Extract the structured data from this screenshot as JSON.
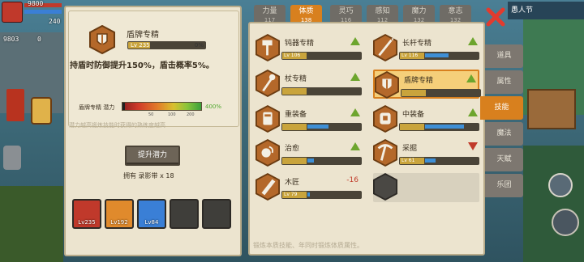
{
  "hud": {
    "top_numbers": [
      "9800",
      "240"
    ],
    "side_numbers": [
      "9803",
      "0"
    ]
  },
  "left_panel": {
    "skill_name": "盾牌专精",
    "level_label": "Lv 235",
    "level_fill": 0.28,
    "progress_pct": "0%",
    "effect_text": "持盾时防御提升150%，盾击概率5%。",
    "potential_label": "盾牌专精 潜力",
    "potential_ticks": [
      "50",
      "100",
      "200"
    ],
    "potential_max": "400%",
    "potential_note": "潜力越高锻炼技能时获得的熟练度越高",
    "upgrade_button": "提升潜力",
    "owned_text": "拥有 录影带 x 18",
    "slots": [
      {
        "level": "Lv235",
        "color": "#c0392b"
      },
      {
        "level": "Lv192",
        "color": "#e08a2c"
      },
      {
        "level": "Lv84",
        "color": "#3a7fd6"
      },
      {
        "level": "",
        "color": "#3f3e3a"
      },
      {
        "level": "",
        "color": "#3f3e3a"
      }
    ]
  },
  "stat_tabs": [
    {
      "name": "力量",
      "value": "117"
    },
    {
      "name": "体质",
      "value": "138"
    },
    {
      "name": "灵巧",
      "value": "116"
    },
    {
      "name": "感知",
      "value": "112"
    },
    {
      "name": "魔力",
      "value": "132"
    },
    {
      "name": "意志",
      "value": "132"
    }
  ],
  "skills": [
    {
      "name": "钝器专精",
      "level": "Lv 106",
      "xp": 0.0,
      "trend": "up",
      "icon": "hammer-icon"
    },
    {
      "name": "长杆专精",
      "level": "Lv 116",
      "xp": 0.45,
      "trend": "up",
      "icon": "spear-icon"
    },
    {
      "name": "杖专精",
      "level": "",
      "xp": 0.0,
      "trend": "up",
      "icon": "staff-icon"
    },
    {
      "name": "盾牌专精",
      "level": "",
      "xp": 0.0,
      "trend": "up",
      "icon": "shield-icon"
    },
    {
      "name": "重装备",
      "level": "",
      "xp": 0.4,
      "trend": "up",
      "icon": "heavy-armor-icon"
    },
    {
      "name": "中装备",
      "level": "",
      "xp": 0.75,
      "trend": "up",
      "icon": "medium-armor-icon"
    },
    {
      "name": "治愈",
      "level": "",
      "xp": 0.12,
      "trend": "up",
      "icon": "heal-icon"
    },
    {
      "name": "采掘",
      "level": "Lv 61",
      "xp": 0.2,
      "trend": "down",
      "icon": "pickaxe-icon"
    },
    {
      "name": "木匠",
      "level": "Lv 79",
      "xp": 0.04,
      "trend": "-16",
      "icon": "saw-icon"
    },
    {
      "name": "",
      "level": "",
      "xp": 0,
      "trend": "",
      "icon": "empty-slot-icon"
    }
  ],
  "side_tabs": [
    "道具",
    "属性",
    "技能",
    "魔法",
    "天赋",
    "乐团"
  ],
  "active_side_tab": "技能",
  "footer_note": "锻炼本质技能、年同时锻炼体质属性。",
  "top_right_label": "愚人节"
}
